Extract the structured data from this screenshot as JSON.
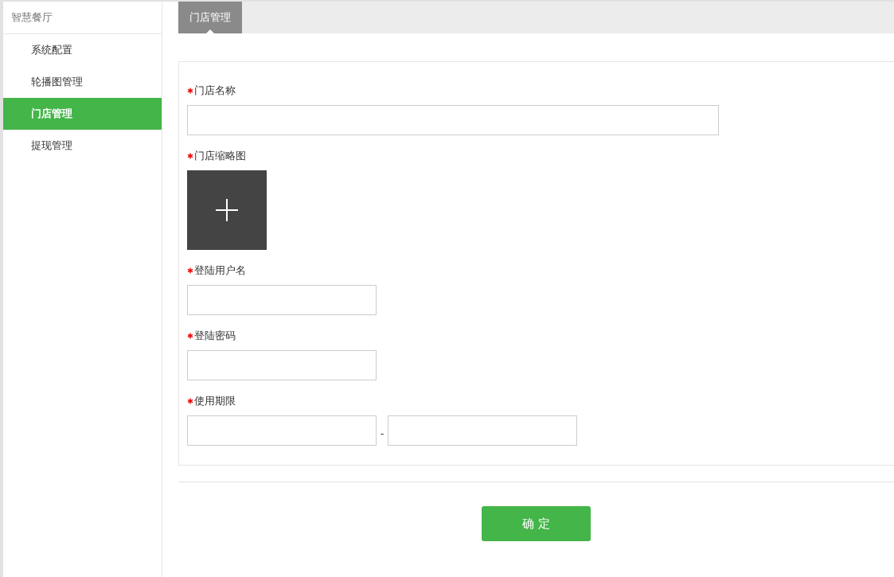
{
  "sidebar": {
    "title": "智慧餐厅",
    "items": [
      {
        "label": "系统配置",
        "selected": false
      },
      {
        "label": "轮播图管理",
        "selected": false
      },
      {
        "label": "门店管理",
        "selected": true
      },
      {
        "label": "提现管理",
        "selected": false
      }
    ]
  },
  "tabs": [
    {
      "label": "门店管理",
      "selected": true
    }
  ],
  "form": {
    "fields": [
      {
        "kind": "text",
        "label": "门店名称",
        "required": true,
        "wide": true
      },
      {
        "kind": "upload",
        "label": "门店缩略图",
        "required": true
      },
      {
        "kind": "text",
        "label": "登陆用户名",
        "required": true,
        "wide": false
      },
      {
        "kind": "password",
        "label": "登陆密码",
        "required": true,
        "wide": false
      },
      {
        "kind": "range",
        "label": "使用期限",
        "required": true,
        "separator": "-"
      }
    ],
    "submit": "确 定"
  }
}
